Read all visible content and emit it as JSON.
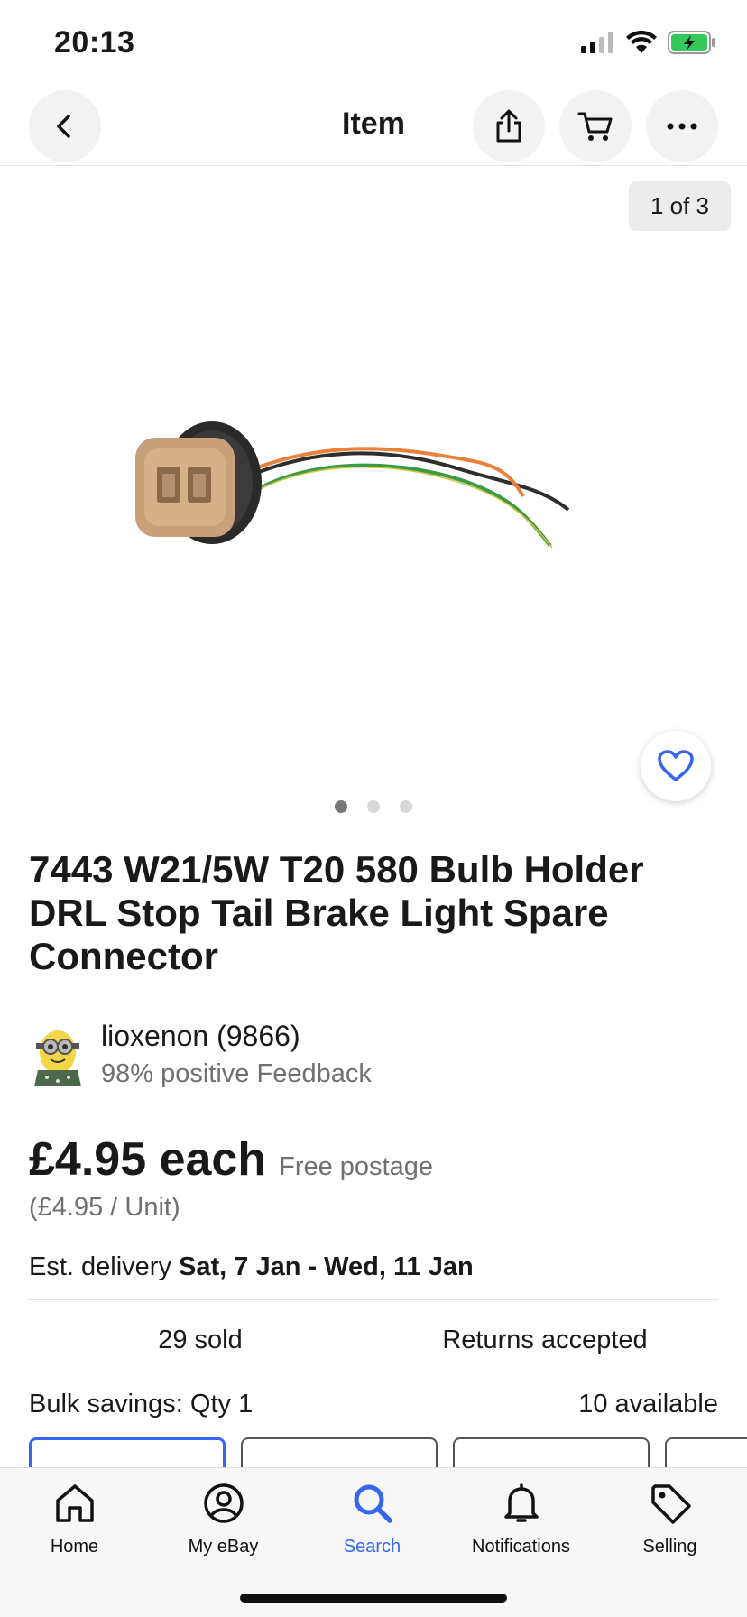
{
  "status_bar": {
    "time": "20:13"
  },
  "header": {
    "title": "Item"
  },
  "gallery": {
    "counter": "1 of 3",
    "total_images": 3,
    "current_index": 1
  },
  "product": {
    "title": "7443 W21/5W T20 580 Bulb Holder DRL Stop Tail Brake Light Spare Connector"
  },
  "seller": {
    "name": "lioxenon (9866)",
    "feedback": "98% positive Feedback"
  },
  "pricing": {
    "price": "£4.95 each",
    "postage": "Free postage",
    "unit_price": "(£4.95 / Unit)"
  },
  "delivery": {
    "label": "Est. delivery",
    "dates": "Sat, 7 Jan - Wed, 11 Jan"
  },
  "stats": {
    "sold": "29 sold",
    "returns": "Returns accepted"
  },
  "bulk": {
    "label": "Bulk savings: Qty 1",
    "available": "10 available"
  },
  "tabs": [
    {
      "label": "Home",
      "icon": "home-icon"
    },
    {
      "label": "My eBay",
      "icon": "user-icon"
    },
    {
      "label": "Search",
      "icon": "search-icon"
    },
    {
      "label": "Notifications",
      "icon": "bell-icon"
    },
    {
      "label": "Selling",
      "icon": "tag-icon"
    }
  ],
  "colors": {
    "accent": "#3665f3",
    "text": "#191919",
    "muted": "#707070"
  }
}
